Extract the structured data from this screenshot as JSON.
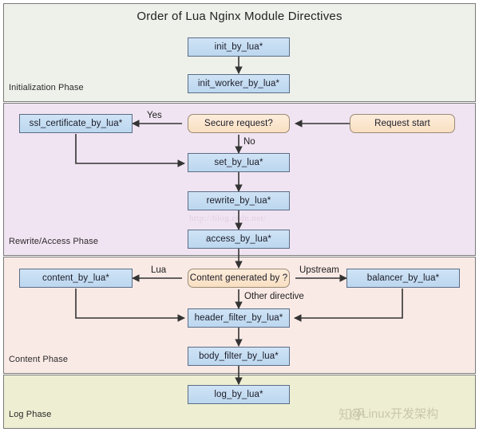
{
  "title": "Order of Lua Nginx Module Directives",
  "phases": [
    {
      "id": "initialization",
      "label": "Initialization Phase",
      "color": "#eef1ea"
    },
    {
      "id": "rewrite_access",
      "label": "Rewrite/Access Phase",
      "color": "#f1e4f2"
    },
    {
      "id": "content",
      "label": "Content Phase",
      "color": "#faeae6"
    },
    {
      "id": "log",
      "label": "Log Phase",
      "color": "#eeeed3"
    }
  ],
  "nodes": {
    "init_by_lua": "init_by_lua*",
    "init_worker_by_lua": "init_worker_by_lua*",
    "request_start": "Request start",
    "secure_request": "Secure request?",
    "ssl_certificate_by_lua": "ssl_certificate_by_lua*",
    "set_by_lua": "set_by_lua*",
    "rewrite_by_lua": "rewrite_by_lua*",
    "access_by_lua": "access_by_lua*",
    "content_generated_by": "Content generated by ?",
    "content_by_lua": "content_by_lua*",
    "balancer_by_lua": "balancer_by_lua*",
    "header_filter_by_lua": "header_filter_by_lua*",
    "body_filter_by_lua": "body_filter_by_lua*",
    "log_by_lua": "log_by_lua*"
  },
  "edge_labels": {
    "yes": "Yes",
    "no": "No",
    "lua": "Lua",
    "upstream": "Upstream",
    "other_directive": "Other directive"
  },
  "watermarks": {
    "csdn": "http://blog.csdn.net/",
    "zhihu": "知乎",
    "zhihu_handle": "@Linux开发架构"
  },
  "colors": {
    "process_fill": "#c2dbf0",
    "process_border": "#5a6d86",
    "decision_fill": "#fbe2c4",
    "decision_border": "#9a8a74",
    "band_border": "#7a7a7a",
    "connector": "#333333"
  }
}
